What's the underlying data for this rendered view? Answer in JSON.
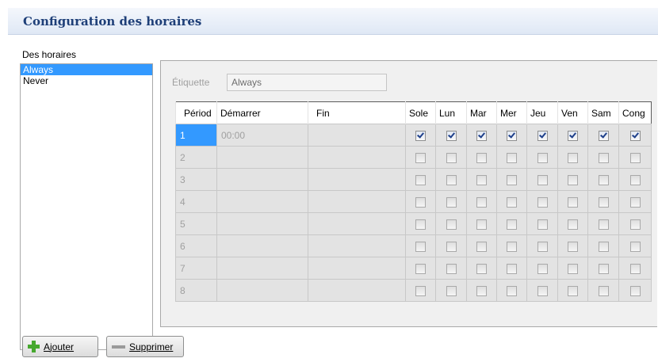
{
  "header": {
    "title": "Configuration des horaires"
  },
  "schedules": {
    "label": "Des horaires",
    "items": [
      {
        "label": "Always",
        "selected": true
      },
      {
        "label": "Never",
        "selected": false
      }
    ]
  },
  "editor": {
    "tag_label": "Étiquette",
    "tag_value": "Always",
    "grid": {
      "columns": {
        "period": "Périod",
        "start": "Démarrer",
        "end": "Fin",
        "days": [
          "Sole",
          "Lun",
          "Mar",
          "Mer",
          "Jeu",
          "Ven",
          "Sam",
          "Cong"
        ]
      },
      "rows": [
        {
          "period": "1",
          "start": "00:00",
          "end": "",
          "days": [
            true,
            true,
            true,
            true,
            true,
            true,
            true,
            true
          ]
        },
        {
          "period": "2",
          "start": "",
          "end": "",
          "days": [
            false,
            false,
            false,
            false,
            false,
            false,
            false,
            false
          ]
        },
        {
          "period": "3",
          "start": "",
          "end": "",
          "days": [
            false,
            false,
            false,
            false,
            false,
            false,
            false,
            false
          ]
        },
        {
          "period": "4",
          "start": "",
          "end": "",
          "days": [
            false,
            false,
            false,
            false,
            false,
            false,
            false,
            false
          ]
        },
        {
          "period": "5",
          "start": "",
          "end": "",
          "days": [
            false,
            false,
            false,
            false,
            false,
            false,
            false,
            false
          ]
        },
        {
          "period": "6",
          "start": "",
          "end": "",
          "days": [
            false,
            false,
            false,
            false,
            false,
            false,
            false,
            false
          ]
        },
        {
          "period": "7",
          "start": "",
          "end": "",
          "days": [
            false,
            false,
            false,
            false,
            false,
            false,
            false,
            false
          ]
        },
        {
          "period": "8",
          "start": "",
          "end": "",
          "days": [
            false,
            false,
            false,
            false,
            false,
            false,
            false,
            false
          ]
        }
      ]
    }
  },
  "buttons": {
    "add": "Ajouter",
    "delete": "Supprimer"
  },
  "colors": {
    "title": "#1e3f78",
    "selection": "#3399ff",
    "add_icon": "#46a82e"
  }
}
